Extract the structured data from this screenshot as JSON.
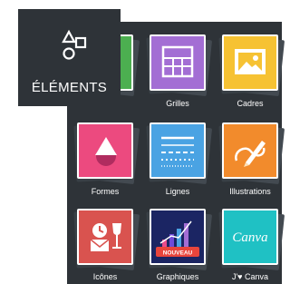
{
  "nav": {
    "elements_label": "ÉLÉMENTS"
  },
  "tiles": [
    {
      "label": ""
    },
    {
      "label": "Grilles"
    },
    {
      "label": "Cadres"
    },
    {
      "label": "Formes"
    },
    {
      "label": "Lignes"
    },
    {
      "label": "Illustrations"
    },
    {
      "label": "Icônes"
    },
    {
      "label": "Graphiques",
      "badge": "NOUVEAU"
    },
    {
      "label": "J'♥ Canva",
      "logo_text": "Canva"
    }
  ],
  "colors": {
    "panel": "#2e3338",
    "green": "#4caf50",
    "purple": "#a36ed4",
    "yellow": "#f6c233",
    "pink": "#ec4a7f",
    "blue": "#4aa3e3",
    "orange": "#f28b2c",
    "red": "#d9534f",
    "navy": "#1b2563",
    "teal": "#1fc1c4"
  }
}
